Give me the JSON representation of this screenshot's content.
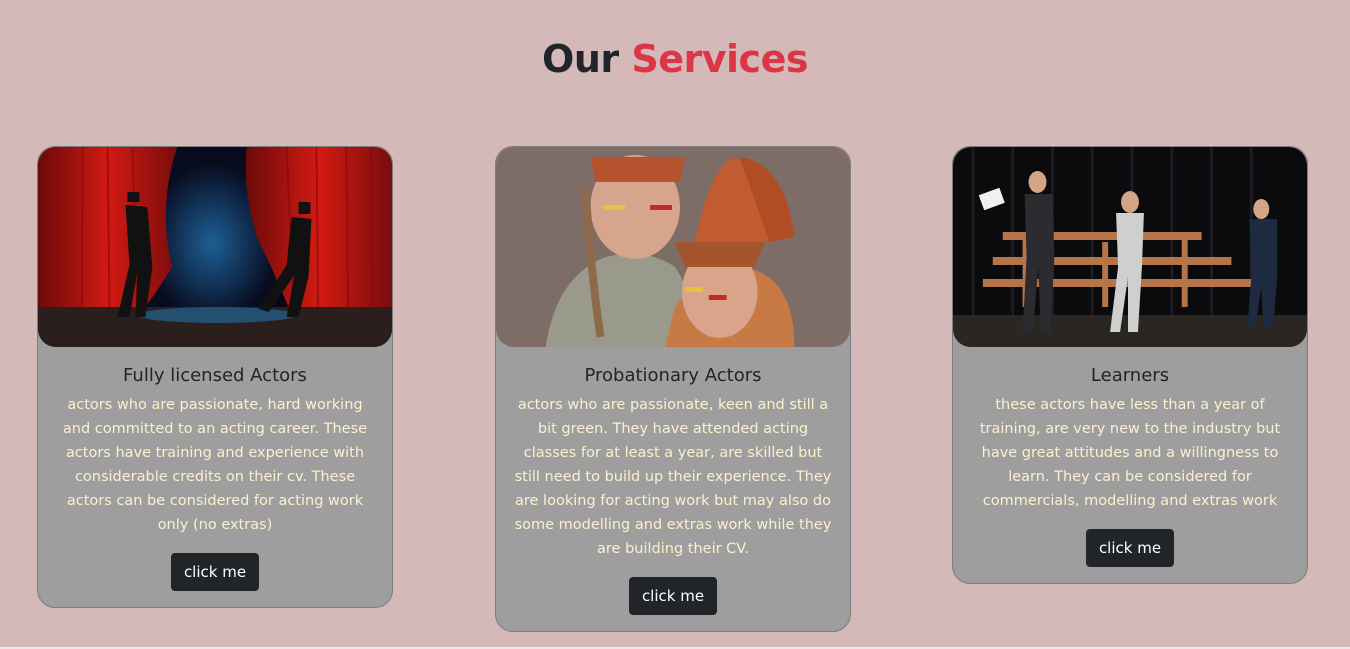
{
  "header": {
    "title_part1": "Our",
    "title_part2": "Services"
  },
  "colors": {
    "background": "#d5b9b9",
    "accent": "#dc3545",
    "card": "#9e9e9e",
    "button": "#212529",
    "card_text": "#fdf0d0"
  },
  "cards": [
    {
      "image": "stage-performers-red-curtain",
      "title": "Fully licensed Actors",
      "text": "actors who are passionate, hard working and committed to an acting career. These actors have training and experience with considerable credits on their cv. These actors can be considered for acting work only (no extras)",
      "button": "click me"
    },
    {
      "image": "children-in-costume",
      "title": "Probationary Actors",
      "text": "actors who are passionate, keen and still a bit green. They have attended acting classes for at least a year, are skilled but still need to build up their experience. They are looking for acting work but may also do some modelling and extras work while they are building their CV.",
      "button": "click me"
    },
    {
      "image": "stage-rehearsal",
      "title": "Learners",
      "text": "these actors have less than a year of training, are very new to the industry but have great attitudes and a willingness to learn. They can be considered for commercials, modelling and extras work",
      "button": "click me"
    }
  ]
}
